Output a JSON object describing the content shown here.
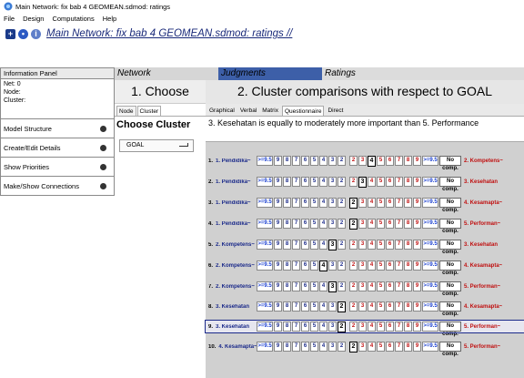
{
  "window": {
    "title": "Main Network: fix bab 4 GEOMEAN.sdmod: ratings"
  },
  "menu": [
    "File",
    "Design",
    "Computations",
    "Help"
  ],
  "toolbar": {
    "breadcrumb": "Main Network: fix bab 4 GEOMEAN.sdmod: ratings //"
  },
  "left_panel": {
    "header": "Information Panel",
    "info_lines": [
      "Net: 0",
      "Node:",
      "Cluster:"
    ],
    "items": [
      "Model Structure",
      "Create/Edit Details",
      "Show Priorities",
      "Make/Show Connections"
    ]
  },
  "tabs": [
    "Network",
    "Judgments",
    "Ratings"
  ],
  "choose": {
    "heading": "1. Choose",
    "subtabs": [
      "Node",
      "Cluster"
    ],
    "cluster_title": "Choose Cluster",
    "selected_cluster": "GOAL"
  },
  "main": {
    "heading": "2. Cluster comparisons with respect to GOAL",
    "tabs": [
      "Graphical",
      "Verbal",
      "Matrix",
      "Questionnaire",
      "Direct"
    ],
    "statement": "3. Kesehatan is equally to moderately more important than  5. Performance",
    "ext_label": ">=9.5",
    "no_comp_label": "No comp.",
    "left_scale": [
      "9",
      "8",
      "7",
      "6",
      "5",
      "4",
      "3",
      "2"
    ],
    "right_scale": [
      "2",
      "3",
      "4",
      "5",
      "6",
      "7",
      "8",
      "9"
    ],
    "center_value": "1",
    "rows": [
      {
        "num": "1.",
        "left": "1. Pendidika~",
        "right": "2. Kompetens~",
        "selected_side": "right",
        "selected_value": "4"
      },
      {
        "num": "2.",
        "left": "1. Pendidika~",
        "right": "3. Kesehatan",
        "selected_side": "right",
        "selected_value": "3"
      },
      {
        "num": "3.",
        "left": "1. Pendidika~",
        "right": "4. Kesamapta~",
        "selected_side": "right",
        "selected_value": "2"
      },
      {
        "num": "4.",
        "left": "1. Pendidika~",
        "right": "5. Performan~",
        "selected_side": "right",
        "selected_value": "2"
      },
      {
        "num": "5.",
        "left": "2. Kompetens~",
        "right": "3. Kesehatan",
        "selected_side": "left",
        "selected_value": "3"
      },
      {
        "num": "6.",
        "left": "2. Kompetens~",
        "right": "4. Kesamapta~",
        "selected_side": "left",
        "selected_value": "4"
      },
      {
        "num": "7.",
        "left": "2. Kompetens~",
        "right": "5. Performan~",
        "selected_side": "left",
        "selected_value": "3"
      },
      {
        "num": "8.",
        "left": "3. Kesehatan",
        "right": "4. Kesamapta~",
        "selected_side": "left",
        "selected_value": "2"
      },
      {
        "num": "9.",
        "left": "3. Kesehatan",
        "right": "5. Performan~",
        "selected_side": "left",
        "selected_value": "2"
      },
      {
        "num": "10.",
        "left": "4. Kesamapta~",
        "right": "5. Performan~",
        "selected_side": "right",
        "selected_value": "2"
      }
    ],
    "selected_row": 9
  }
}
